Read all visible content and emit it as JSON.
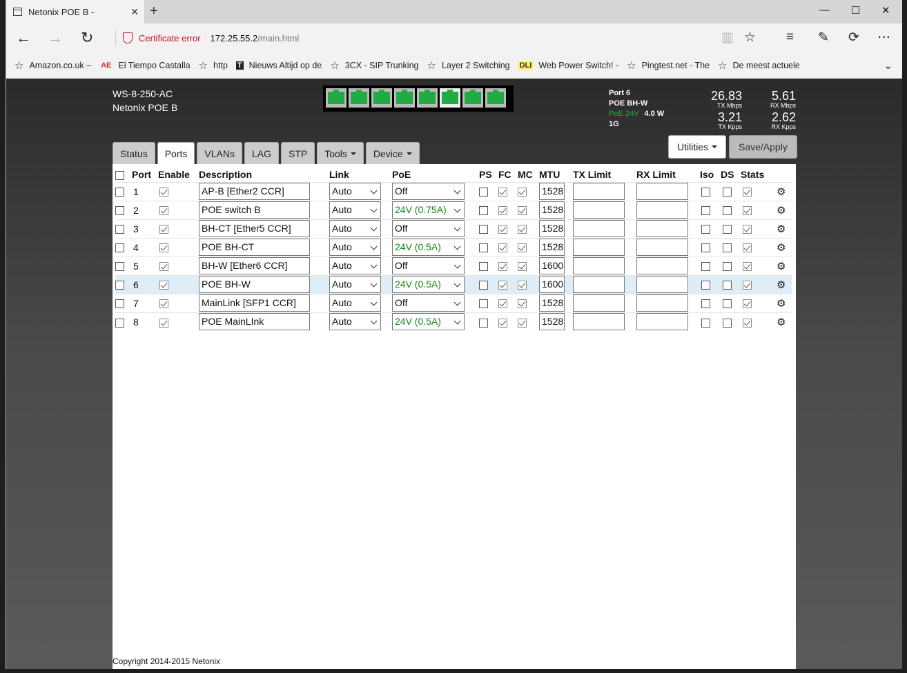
{
  "browser": {
    "tab_title": "Netonix POE B -",
    "new_tab_glyph": "+",
    "cert_label": "Certificate error",
    "url_host": "172.25.55.2",
    "url_path": "/main.html",
    "favorites": [
      {
        "icon": "star-icon",
        "label": "Amazon.co.uk –"
      },
      {
        "icon": "ae-icon",
        "glyph": "AE",
        "label": "El Tiempo Castalla"
      },
      {
        "icon": "star-icon",
        "label": "http"
      },
      {
        "icon": "nyt-icon",
        "glyph": "T",
        "label": "Nieuws  Altijd op de"
      },
      {
        "icon": "star-icon",
        "label": "3CX - SIP Trunking"
      },
      {
        "icon": "star-icon",
        "label": "Layer 2 Switching"
      },
      {
        "icon": "dli-icon",
        "glyph": "DLI",
        "label": "Web Power Switch! -"
      },
      {
        "icon": "star-icon",
        "label": "Pingtest.net - The"
      },
      {
        "icon": "star-icon",
        "label": "De meest actuele"
      }
    ]
  },
  "device": {
    "model": "WS-8-250-AC",
    "name": "Netonix POE B",
    "active_port_index": 5,
    "port_count": 8
  },
  "port_info": {
    "port": "Port 6",
    "desc": "POE BH-W",
    "poe": "PoE 24V",
    "watts": "4.0 W",
    "speed": "1G"
  },
  "stats": {
    "tx_mbps": "26.83",
    "tx_mbps_label": "TX Mbps",
    "rx_mbps": "5.61",
    "rx_mbps_label": "RX Mbps",
    "tx_kpps": "3.21",
    "tx_kpps_label": "TX Kpps",
    "rx_kpps": "2.62",
    "rx_kpps_label": "RX Kpps"
  },
  "nav": {
    "tabs": [
      {
        "label": "Status",
        "name": "tab-status",
        "dropdown": false,
        "active": false
      },
      {
        "label": "Ports",
        "name": "tab-ports",
        "dropdown": false,
        "active": true
      },
      {
        "label": "VLANs",
        "name": "tab-vlans",
        "dropdown": false,
        "active": false
      },
      {
        "label": "LAG",
        "name": "tab-lag",
        "dropdown": false,
        "active": false
      },
      {
        "label": "STP",
        "name": "tab-stp",
        "dropdown": false,
        "active": false
      },
      {
        "label": "Tools",
        "name": "tab-tools",
        "dropdown": true,
        "active": false
      },
      {
        "label": "Device",
        "name": "tab-device",
        "dropdown": true,
        "active": false
      }
    ],
    "utilities_label": "Utilities",
    "save_label": "Save/Apply"
  },
  "table": {
    "headers": {
      "port": "Port",
      "enable": "Enable",
      "description": "Description",
      "link": "Link",
      "poe": "PoE",
      "ps": "PS",
      "fc": "FC",
      "mc": "MC",
      "mtu": "MTU",
      "tx_limit": "TX Limit",
      "rx_limit": "RX Limit",
      "iso": "Iso",
      "ds": "DS",
      "stats": "Stats"
    },
    "rows": [
      {
        "port": "1",
        "enable": true,
        "description": "AP-B [Ether2 CCR]",
        "link": "Auto",
        "poe": "Off",
        "ps": false,
        "fc": true,
        "mc": true,
        "mtu": "1528",
        "tx_limit": "",
        "rx_limit": "",
        "iso": false,
        "ds": false,
        "stats": true
      },
      {
        "port": "2",
        "enable": true,
        "description": "POE switch B",
        "link": "Auto",
        "poe": "24V (0.75A)",
        "ps": false,
        "fc": true,
        "mc": true,
        "mtu": "1528",
        "tx_limit": "",
        "rx_limit": "",
        "iso": false,
        "ds": false,
        "stats": true
      },
      {
        "port": "3",
        "enable": true,
        "description": "BH-CT [Ether5 CCR]",
        "link": "Auto",
        "poe": "Off",
        "ps": false,
        "fc": true,
        "mc": true,
        "mtu": "1528",
        "tx_limit": "",
        "rx_limit": "",
        "iso": false,
        "ds": false,
        "stats": true
      },
      {
        "port": "4",
        "enable": true,
        "description": "POE BH-CT",
        "link": "Auto",
        "poe": "24V (0.5A)",
        "ps": false,
        "fc": true,
        "mc": true,
        "mtu": "1528",
        "tx_limit": "",
        "rx_limit": "",
        "iso": false,
        "ds": false,
        "stats": true
      },
      {
        "port": "5",
        "enable": true,
        "description": "BH-W [Ether6 CCR]",
        "link": "Auto",
        "poe": "Off",
        "ps": false,
        "fc": true,
        "mc": true,
        "mtu": "1600",
        "tx_limit": "",
        "rx_limit": "",
        "iso": false,
        "ds": false,
        "stats": true
      },
      {
        "port": "6",
        "enable": true,
        "description": "POE BH-W",
        "link": "Auto",
        "poe": "24V (0.5A)",
        "ps": false,
        "fc": true,
        "mc": true,
        "mtu": "1600",
        "tx_limit": "",
        "rx_limit": "",
        "iso": false,
        "ds": false,
        "stats": true,
        "highlight": true
      },
      {
        "port": "7",
        "enable": true,
        "description": "MainLink [SFP1 CCR]",
        "link": "Auto",
        "poe": "Off",
        "ps": false,
        "fc": true,
        "mc": true,
        "mtu": "1528",
        "tx_limit": "",
        "rx_limit": "",
        "iso": false,
        "ds": false,
        "stats": true
      },
      {
        "port": "8",
        "enable": true,
        "description": "POE MainLInk",
        "link": "Auto",
        "poe": "24V (0.5A)",
        "ps": false,
        "fc": true,
        "mc": true,
        "mtu": "1528",
        "tx_limit": "",
        "rx_limit": "",
        "iso": false,
        "ds": false,
        "stats": true
      }
    ]
  },
  "footer": {
    "copyright": "Copyright 2014-2015 Netonix"
  },
  "colors": {
    "poe_green": "#118811",
    "led_green": "#22aa44",
    "cert_red": "#c8102e",
    "row_highlight": "#dfeef6"
  }
}
